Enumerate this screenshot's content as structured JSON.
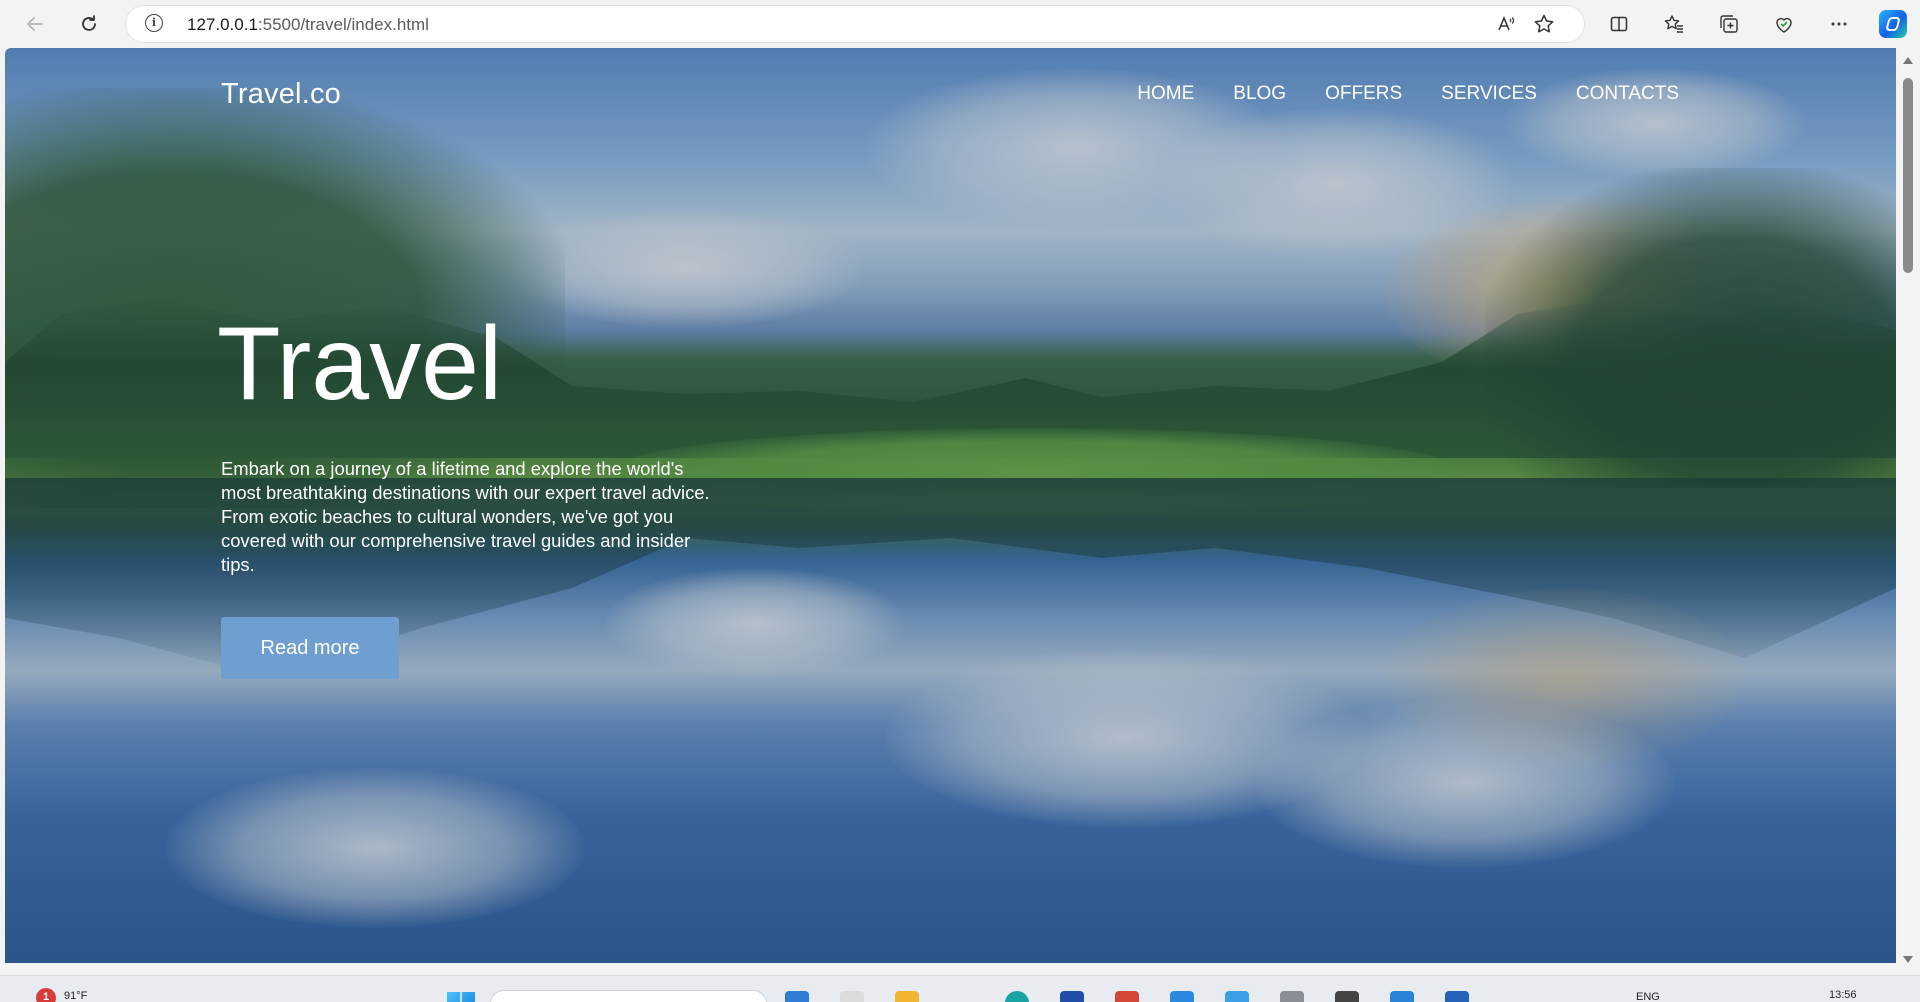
{
  "browser": {
    "url_host": "127.0.0.1",
    "url_path": ":5500/travel/index.html"
  },
  "site": {
    "brand": "Travel.co",
    "nav": [
      "HOME",
      "BLOG",
      "OFFERS",
      "SERVICES",
      "CONTACTS"
    ],
    "hero_title": "Travel",
    "hero_text": "Embark on a journey of a lifetime and explore the world's most breathtaking destinations with our expert travel advice. From exotic beaches to cultural wonders, we've got you covered with our comprehensive travel guides and insider tips.",
    "cta_label": "Read more"
  },
  "taskbar": {
    "weather_alert_count": "1",
    "weather_temp": "91°F",
    "language": "ENG",
    "time": "13:56"
  },
  "icons": [
    "back-icon",
    "reload-icon",
    "info-icon",
    "read-aloud-icon",
    "favorite-star-icon",
    "split-screen-icon",
    "favorites-icon",
    "collections-icon",
    "browser-essentials-icon",
    "more-icon",
    "copilot-icon"
  ]
}
